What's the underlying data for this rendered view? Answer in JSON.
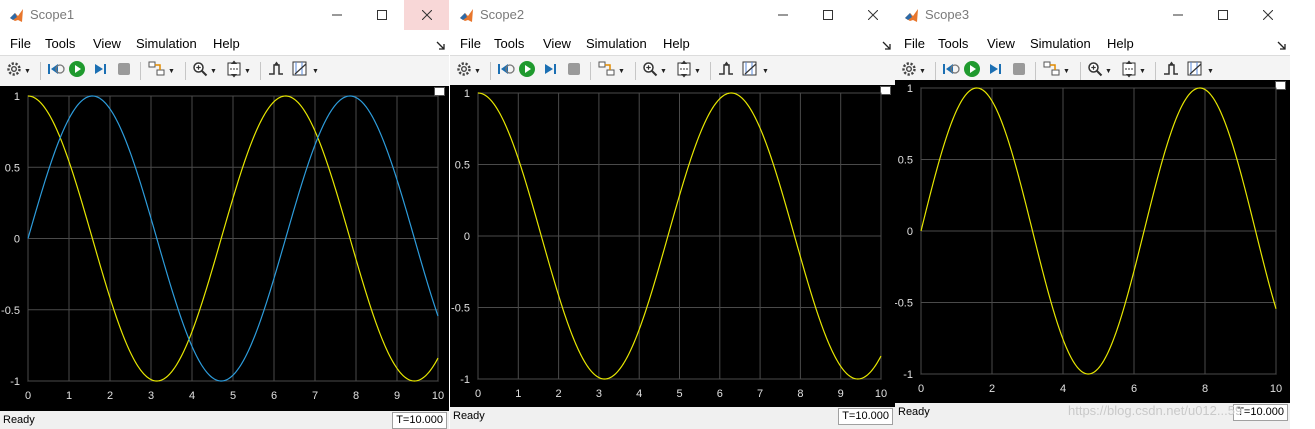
{
  "windows": [
    {
      "id": "scope1",
      "title": "Scope1",
      "menu": [
        "File",
        "Tools",
        "View",
        "Simulation",
        "Help"
      ],
      "status": "Ready",
      "time": "T=10.000",
      "xticks": [
        "0",
        "1",
        "2",
        "3",
        "4",
        "5",
        "6",
        "7",
        "8",
        "9",
        "10"
      ],
      "yticks": [
        "1",
        "0.5",
        "0",
        "-0.5",
        "-1"
      ],
      "close_highlighted": true
    },
    {
      "id": "scope2",
      "title": "Scope2",
      "menu": [
        "File",
        "Tools",
        "View",
        "Simulation",
        "Help"
      ],
      "status": "Ready",
      "time": "T=10.000",
      "xticks": [
        "0",
        "1",
        "2",
        "3",
        "4",
        "5",
        "6",
        "7",
        "8",
        "9",
        "10"
      ],
      "yticks": [
        "1",
        "0.5",
        "0",
        "-0.5",
        "-1"
      ],
      "close_highlighted": false
    },
    {
      "id": "scope3",
      "title": "Scope3",
      "menu": [
        "File",
        "Tools",
        "View",
        "Simulation",
        "Help"
      ],
      "status": "Ready",
      "time": "T=10.000",
      "xticks": [
        "0",
        "2",
        "4",
        "6",
        "8",
        "10"
      ],
      "yticks": [
        "1",
        "0.5",
        "0",
        "-0.5",
        "-1"
      ],
      "close_highlighted": false
    }
  ],
  "chart_data": [
    {
      "type": "line",
      "xlim": [
        0,
        10
      ],
      "ylim": [
        -1,
        1
      ],
      "grid": true,
      "series": [
        {
          "function": "cos(t)",
          "color": "#e6e600"
        },
        {
          "function": "sin(t)",
          "color": "#2d9cdb"
        }
      ],
      "x": [
        0,
        1,
        2,
        3,
        4,
        5,
        6,
        7,
        8,
        9,
        10
      ]
    },
    {
      "type": "line",
      "xlim": [
        0,
        10
      ],
      "ylim": [
        -1,
        1
      ],
      "grid": true,
      "series": [
        {
          "function": "cos(t)",
          "color": "#e6e600"
        }
      ],
      "x": [
        0,
        1,
        2,
        3,
        4,
        5,
        6,
        7,
        8,
        9,
        10
      ]
    },
    {
      "type": "line",
      "xlim": [
        0,
        10
      ],
      "ylim": [
        -1,
        1
      ],
      "grid": true,
      "series": [
        {
          "function": "sin(t)",
          "color": "#e6e600"
        }
      ],
      "x": [
        0,
        2,
        4,
        6,
        8,
        10
      ]
    }
  ],
  "watermark": "https://blog.csdn.net/u012...59",
  "icons": {
    "toolbar": [
      "gear-icon",
      "step-back-icon",
      "run-icon",
      "step-forward-icon",
      "stop-icon",
      "highlight-simulink-icon",
      "zoom-icon",
      "autoscale-icon",
      "triggers-icon",
      "cursor-measurements-icon"
    ],
    "window_controls": [
      "minimize-icon",
      "maximize-icon",
      "close-icon"
    ]
  }
}
